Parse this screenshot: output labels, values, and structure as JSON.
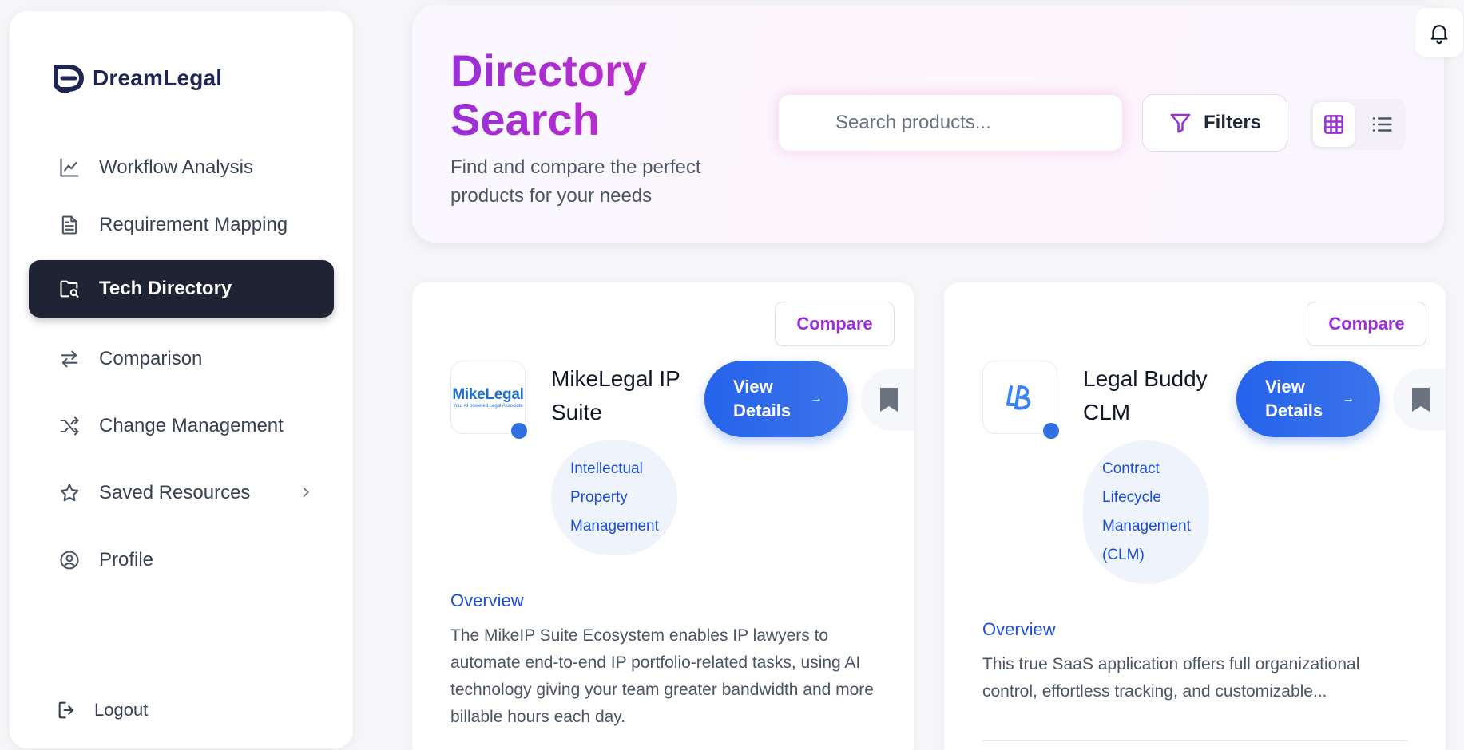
{
  "brand": {
    "name": "DreamLegal"
  },
  "sidebar": {
    "items": [
      {
        "label": "Workflow Analysis",
        "icon": "chart-line-icon",
        "active": false
      },
      {
        "label": "Requirement Mapping",
        "icon": "document-icon",
        "active": false
      },
      {
        "label": "Tech Directory",
        "icon": "folder-search-icon",
        "active": true
      },
      {
        "label": "Comparison",
        "icon": "arrows-swap-icon",
        "active": false
      },
      {
        "label": "Change Management",
        "icon": "shuffle-icon",
        "active": false
      },
      {
        "label": "Saved Resources",
        "icon": "star-icon",
        "active": false,
        "has_submenu": true
      },
      {
        "label": "Profile",
        "icon": "user-circle-icon",
        "active": false
      }
    ],
    "logout_label": "Logout"
  },
  "header": {
    "title": "Directory Search",
    "subtitle": "Find and compare the perfect products for your needs",
    "search_placeholder": "Search products...",
    "filters_label": "Filters",
    "view_mode": "grid"
  },
  "products": [
    {
      "name": "MikeLegal IP Suite",
      "logo_text": "MikeLegal",
      "logo_tagline": "Your AI powered Legal Associate",
      "category": "Intellectual Property Management",
      "compare_label": "Compare",
      "details_label": "View Details",
      "overview_label": "Overview",
      "overview": "The MikeIP Suite Ecosystem enables IP lawyers to automate end-to-end IP portfolio-related tasks, using AI technology giving your team greater bandwidth and more billable hours each day."
    },
    {
      "name": "Legal Buddy CLM",
      "logo_text": "LB",
      "category": "Contract Lifecycle Management (CLM)",
      "compare_label": "Compare",
      "details_label": "View Details",
      "overview_label": "Overview",
      "overview": "This true SaaS application offers full organizational control, effortless tracking, and customizable..."
    }
  ],
  "colors": {
    "accent_purple": "#9b2fd6",
    "primary_blue": "#2563eb",
    "sidebar_active_bg": "#1e2433",
    "status_dot": "#2f6fe0"
  }
}
